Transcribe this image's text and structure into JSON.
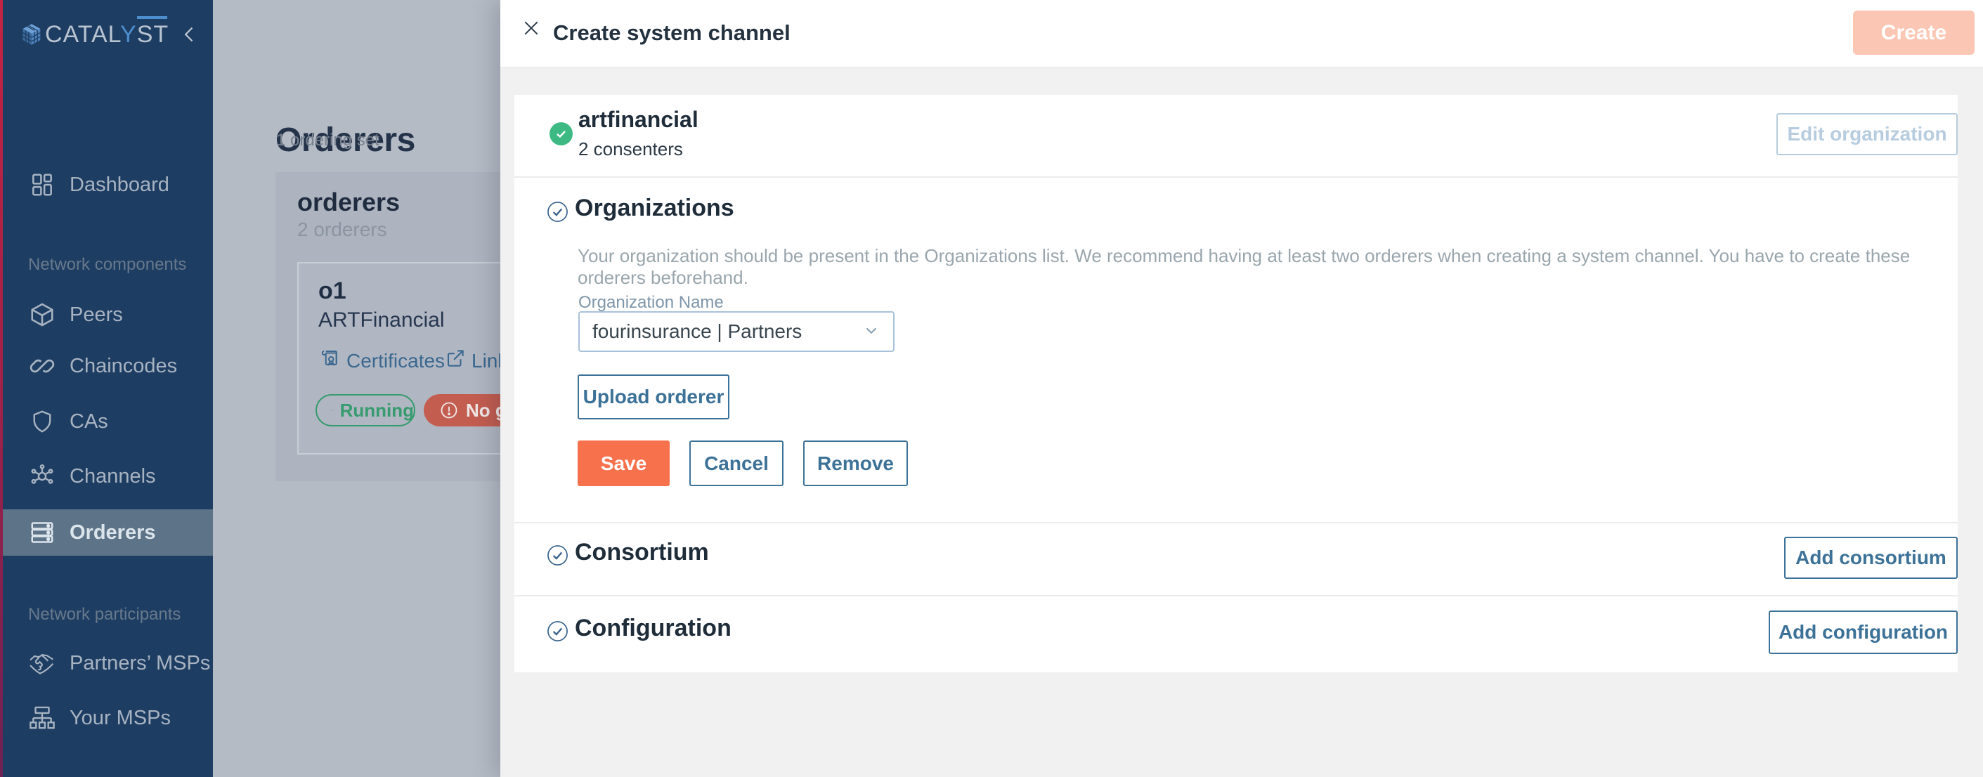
{
  "brand": {
    "name_pre": "CATAL",
    "name_y": "Y",
    "name_post": "ST"
  },
  "sidebar": {
    "sections": [
      {
        "label": "Network components"
      },
      {
        "label": "Network participants"
      }
    ],
    "items": [
      {
        "label": "Dashboard",
        "active": false
      },
      {
        "label": "Peers",
        "active": false
      },
      {
        "label": "Chaincodes",
        "active": false
      },
      {
        "label": "CAs",
        "active": false
      },
      {
        "label": "Channels",
        "active": false
      },
      {
        "label": "Orderers",
        "active": true
      },
      {
        "label": "Partners’ MSPs",
        "active": false
      },
      {
        "label": "Your MSPs",
        "active": false
      }
    ]
  },
  "page": {
    "title": "Orderers",
    "subtitle": "1 ordering set",
    "ordering_set": {
      "name": "orderers",
      "count": "2 orderers",
      "node": {
        "name": "o1",
        "organization": "ARTFinancial",
        "certificates_link": "Certificates",
        "external_link": "Link",
        "status_ok": "Running",
        "status_warn": "No gene"
      }
    }
  },
  "modal": {
    "title": "Create system channel",
    "create_label": "Create",
    "summary": {
      "name": "artfinancial",
      "detail": "2 consenters",
      "edit_label": "Edit organization"
    },
    "organizations": {
      "heading": "Organizations",
      "description": "Your organization should be present in the Organizations list. We recommend having at least two orderers when creating a system channel. You have to create these orderers beforehand.",
      "field_label": "Organization Name",
      "field_value": "fourinsurance | Partners",
      "upload_label": "Upload orderer",
      "save_label": "Save",
      "cancel_label": "Cancel",
      "remove_label": "Remove"
    },
    "consortium": {
      "heading": "Consortium",
      "add_label": "Add consortium"
    },
    "configuration": {
      "heading": "Configuration",
      "add_label": "Add configuration"
    }
  },
  "colors": {
    "sidebar_bg": "#1e3d62",
    "accent_orange": "#f7714d",
    "disabled_orange": "#fbc6b4",
    "accent_blue": "#3d7298",
    "success_green": "#3dba83",
    "warn_red": "#c35d50"
  }
}
